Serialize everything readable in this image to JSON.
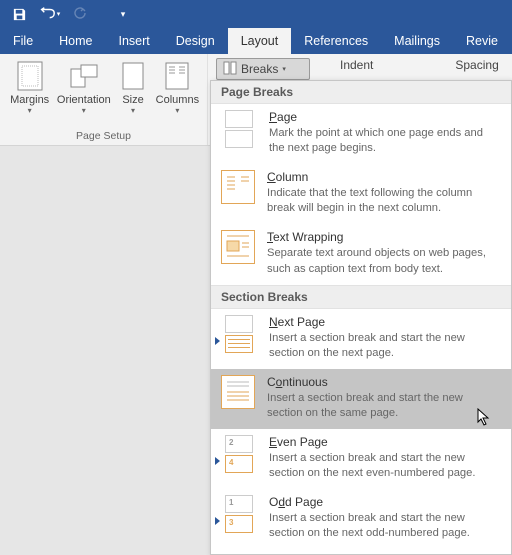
{
  "menubar": [
    "File",
    "Home",
    "Insert",
    "Design",
    "Layout",
    "References",
    "Mailings",
    "Revie"
  ],
  "activeMenuIndex": 4,
  "ribbon": {
    "page_setup_group": "Page Setup",
    "buttons": [
      "Margins",
      "Orientation",
      "Size",
      "Columns"
    ],
    "breaks_btn": "Breaks",
    "indent_label": "Indent",
    "spacing_label": "Spacing"
  },
  "dropdown": {
    "page_breaks_header": "Page Breaks",
    "section_breaks_header": "Section Breaks",
    "items": {
      "page": {
        "title_before": "",
        "key": "P",
        "title_after": "age",
        "desc": "Mark the point at which one page ends and the next page begins."
      },
      "column": {
        "title_before": "",
        "key": "C",
        "title_after": "olumn",
        "desc": "Indicate that the text following the column break will begin in the next column."
      },
      "textwrap": {
        "title_before": "",
        "key": "T",
        "title_after": "ext Wrapping",
        "desc": "Separate text around objects on web pages, such as caption text from body text."
      },
      "nextpage": {
        "title_before": "",
        "key": "N",
        "title_after": "ext Page",
        "desc": "Insert a section break and start the new section on the next page."
      },
      "continuous": {
        "title_before": "C",
        "key": "o",
        "title_after": "ntinuous",
        "desc": "Insert a section break and start the new section on the same page."
      },
      "evenpage": {
        "title_before": "",
        "key": "E",
        "title_after": "ven Page",
        "desc": "Insert a section break and start the new section on the next even-numbered page."
      },
      "oddpage": {
        "title_before": "O",
        "key": "d",
        "title_after": "d Page",
        "desc": "Insert a section break and start the new section on the next odd-numbered page."
      }
    }
  }
}
